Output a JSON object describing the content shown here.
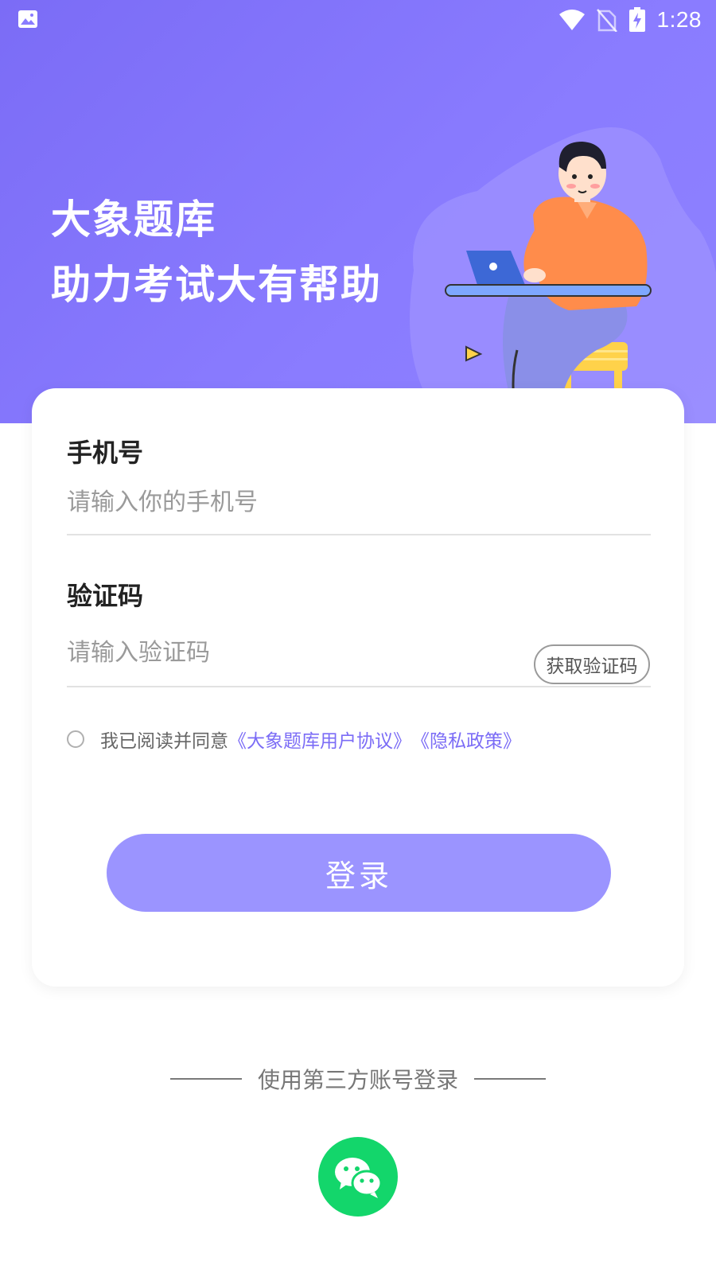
{
  "status_bar": {
    "time": "1:28",
    "icons": [
      "image-icon",
      "wifi-icon",
      "no-sim-icon",
      "battery-charging-icon"
    ]
  },
  "hero": {
    "line1": "大象题库",
    "line2": "助力考试大有帮助",
    "colors": {
      "gradient_start": "#7b6cf6",
      "gradient_end": "#8e82ff"
    }
  },
  "form": {
    "phone_label": "手机号",
    "phone_placeholder": "请输入你的手机号",
    "phone_value": "",
    "code_label": "验证码",
    "code_placeholder": "请输入验证码",
    "code_value": "",
    "get_code_button": "获取验证码",
    "agreement": {
      "checked": false,
      "prefix": "我已阅读并同意",
      "user_agreement": "《大象题库用户协议》",
      "privacy_policy": "《隐私政策》"
    },
    "login_button": "登录"
  },
  "third_party": {
    "label": "使用第三方账号登录",
    "providers": [
      "wechat-icon"
    ]
  },
  "colors": {
    "accent": "#7b6cf6",
    "login_button": "#9b94ff",
    "wechat": "#13d66b"
  }
}
